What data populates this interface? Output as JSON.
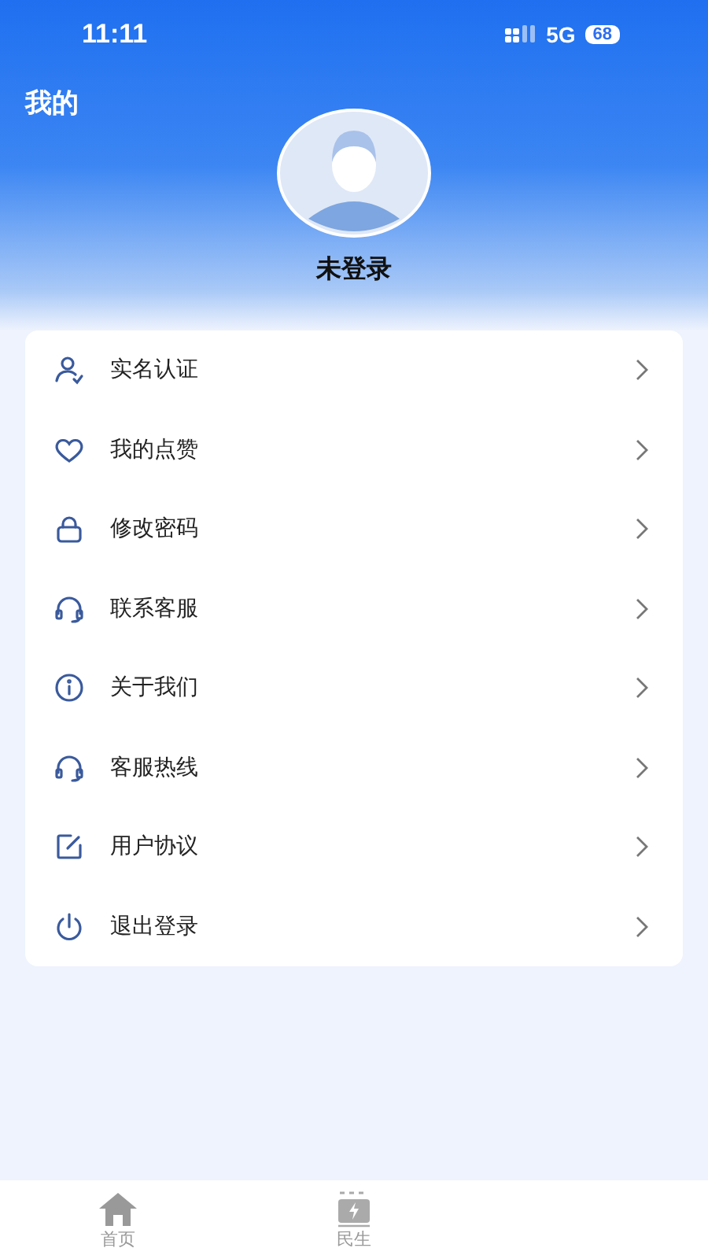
{
  "status_bar": {
    "time": "11:11",
    "network": "5G",
    "battery": "68"
  },
  "header": {
    "title": "我的",
    "username": "未登录"
  },
  "menu": [
    {
      "kind": "user",
      "label": "实名认证"
    },
    {
      "kind": "heart",
      "label": "我的点赞"
    },
    {
      "kind": "lock",
      "label": "修改密码"
    },
    {
      "kind": "headset",
      "label": "联系客服"
    },
    {
      "kind": "info",
      "label": "关于我们"
    },
    {
      "kind": "headset",
      "label": "客服热线"
    },
    {
      "kind": "edit",
      "label": "用户协议"
    },
    {
      "kind": "power",
      "label": "退出登录"
    }
  ],
  "tab_bar": [
    {
      "kind": "home",
      "label": "首页",
      "selected": false
    },
    {
      "kind": "bolt",
      "label": "民生",
      "selected": false
    }
  ]
}
